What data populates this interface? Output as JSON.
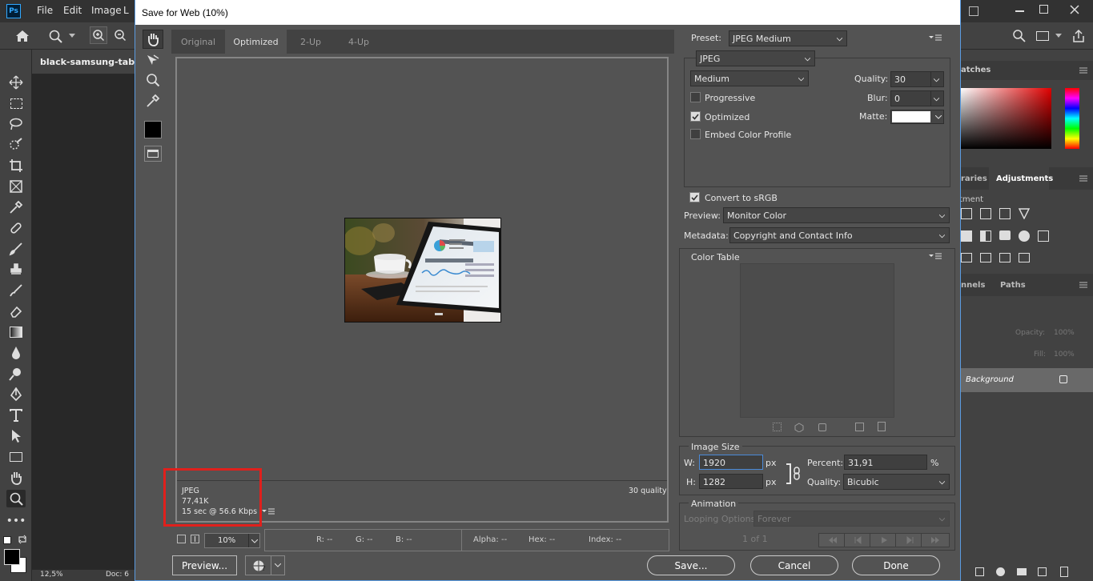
{
  "app": {
    "menu": [
      "File",
      "Edit",
      "Image",
      "L"
    ],
    "document_tab": "black-samsung-tablet-",
    "zoom_status": "12,5%",
    "doc_status": "Doc: 6"
  },
  "right_panels": {
    "swatches_tab": "atches",
    "libraries_tab": "raries",
    "adjustments_tab": "Adjustments",
    "adjustments_sub": "tment",
    "channels_tab": "nnels",
    "paths_tab": "Paths",
    "opacity_label": "Opacity:",
    "opacity_value": "100%",
    "fill_label": "Fill:",
    "fill_value": "100%",
    "layer_name": "Background"
  },
  "dialog": {
    "title": "Save for Web (10%)",
    "tabs": [
      "Original",
      "Optimized",
      "2-Up",
      "4-Up"
    ],
    "active_tab": "Optimized",
    "info": {
      "format": "JPEG",
      "size": "77,41K",
      "time": "15 sec @ 56.6 Kbps",
      "quality": "30 quality"
    },
    "zoom": "10%",
    "readout": {
      "r": "R: --",
      "g": "G: --",
      "b": "B: --",
      "alpha": "Alpha: --",
      "hex": "Hex: --",
      "index": "Index: --"
    },
    "buttons": {
      "preview": "Preview...",
      "save": "Save...",
      "cancel": "Cancel",
      "done": "Done"
    }
  },
  "settings": {
    "preset_label": "Preset:",
    "preset_value": "JPEG Medium",
    "format_value": "JPEG",
    "quality_level": "Medium",
    "quality_label": "Quality:",
    "quality_value": "30",
    "progressive_label": "Progressive",
    "progressive_checked": false,
    "blur_label": "Blur:",
    "blur_value": "0",
    "optimized_label": "Optimized",
    "optimized_checked": true,
    "matte_label": "Matte:",
    "embed_label": "Embed Color Profile",
    "embed_checked": false,
    "convert_label": "Convert to sRGB",
    "convert_checked": true,
    "preview_label": "Preview:",
    "preview_value": "Monitor Color",
    "metadata_label": "Metadata:",
    "metadata_value": "Copyright and Contact Info",
    "color_table_title": "Color Table",
    "image_size_title": "Image Size",
    "w_label": "W:",
    "w_value": "1920",
    "h_label": "H:",
    "h_value": "1282",
    "px_unit": "px",
    "percent_label": "Percent:",
    "percent_value": "31,91",
    "percent_unit": "%",
    "resample_label": "Quality:",
    "resample_value": "Bicubic",
    "animation_title": "Animation",
    "looping_label": "Looping Options:",
    "looping_value": "Forever",
    "frame_counter": "1 of 1"
  },
  "colors": {
    "dialog_bg": "#535353",
    "highlight_red": "#e0201c",
    "accent_blue": "#5a9be0"
  }
}
